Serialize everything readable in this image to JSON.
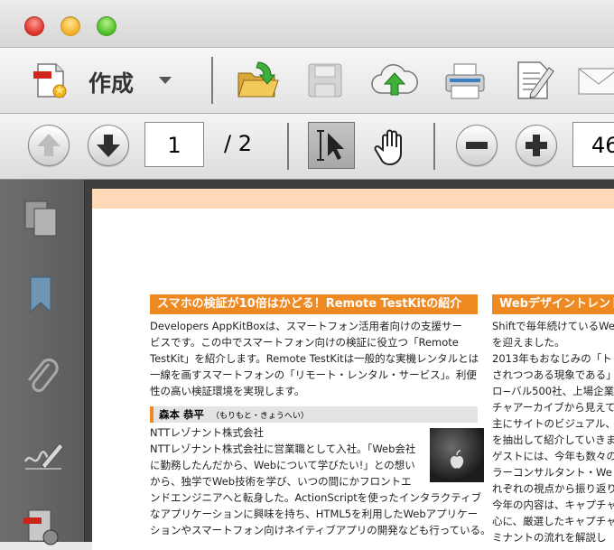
{
  "toolbar": {
    "create_label": "作成",
    "page_current": "1",
    "page_total": "/  2",
    "zoom_value": "46"
  },
  "icons": {
    "close": "close-traffic-light",
    "minimize": "minimize-traffic-light",
    "zoom": "zoom-traffic-light",
    "create": "create-pdf-icon",
    "open": "open-folder-icon",
    "save": "floppy-save-icon",
    "upload": "cloud-upload-icon",
    "print": "printer-icon",
    "edit": "edit-document-icon",
    "mail": "envelope-icon",
    "prev": "arrow-up-icon",
    "next": "arrow-down-icon",
    "select": "select-cursor-icon",
    "hand": "hand-icon",
    "zoom_out": "minus-icon",
    "zoom_in": "plus-icon"
  },
  "colors": {
    "accent": "#ef8a23",
    "band": "#ffd9b8"
  },
  "article_left": {
    "title": "スマホの検証が10倍はかどる！Remote TestKitの紹介",
    "paragraph_lines": [
      "Developers AppKitBoxは、スマートフォン活用者向けの支援サー",
      "ビスです。この中でスマートフォン向けの検証に役立つ「Remote",
      "TestKit」を紹介します。Remote TestKitは一般的な実機レンタルとは",
      "一線を画すスマートフォンの「リモート・レンタル・サービス」。利便",
      "性の高い検証環境を実現します。"
    ],
    "author_name": "森本 恭平",
    "author_kana": "（もりもと・きょうへい）",
    "bio_lines": [
      "NTTレゾナント株式会社",
      "NTTレゾナント株式会社に営業職として入社。「Web会社",
      "に勤務したんだから、Webについて学びたい!」との想い",
      "から、独学でWeb技術を学び、いつの間にかフロントエ",
      "ンドエンジニアへと転身した。ActionScriptを使ったインタラクティブ",
      "なアプリケーションに興味を持ち、HTML5を利用したWebアプリケー",
      "ションやスマートフォン向けネイティブアプリの開発なども行っている。"
    ]
  },
  "article_right": {
    "title": "Webデザイントレンド",
    "lines": [
      "Shiftで毎年続けているWe",
      "を迎えました。",
      "2013年もおなじみの「ト",
      "されつつある現象である」",
      "ロ−バル500社、上場企業",
      "チャアーカイブから見えて",
      "主にサイトのビジュアル、",
      "を抽出して紹介していきま",
      "ゲストには、今年も数々の",
      "ラーコンサルタント・We",
      "れぞれの視点から振り返り",
      "今年の内容は、キャプチャ",
      "心に、厳選したキャプチャ",
      "ミナントの流れを解説し"
    ]
  }
}
